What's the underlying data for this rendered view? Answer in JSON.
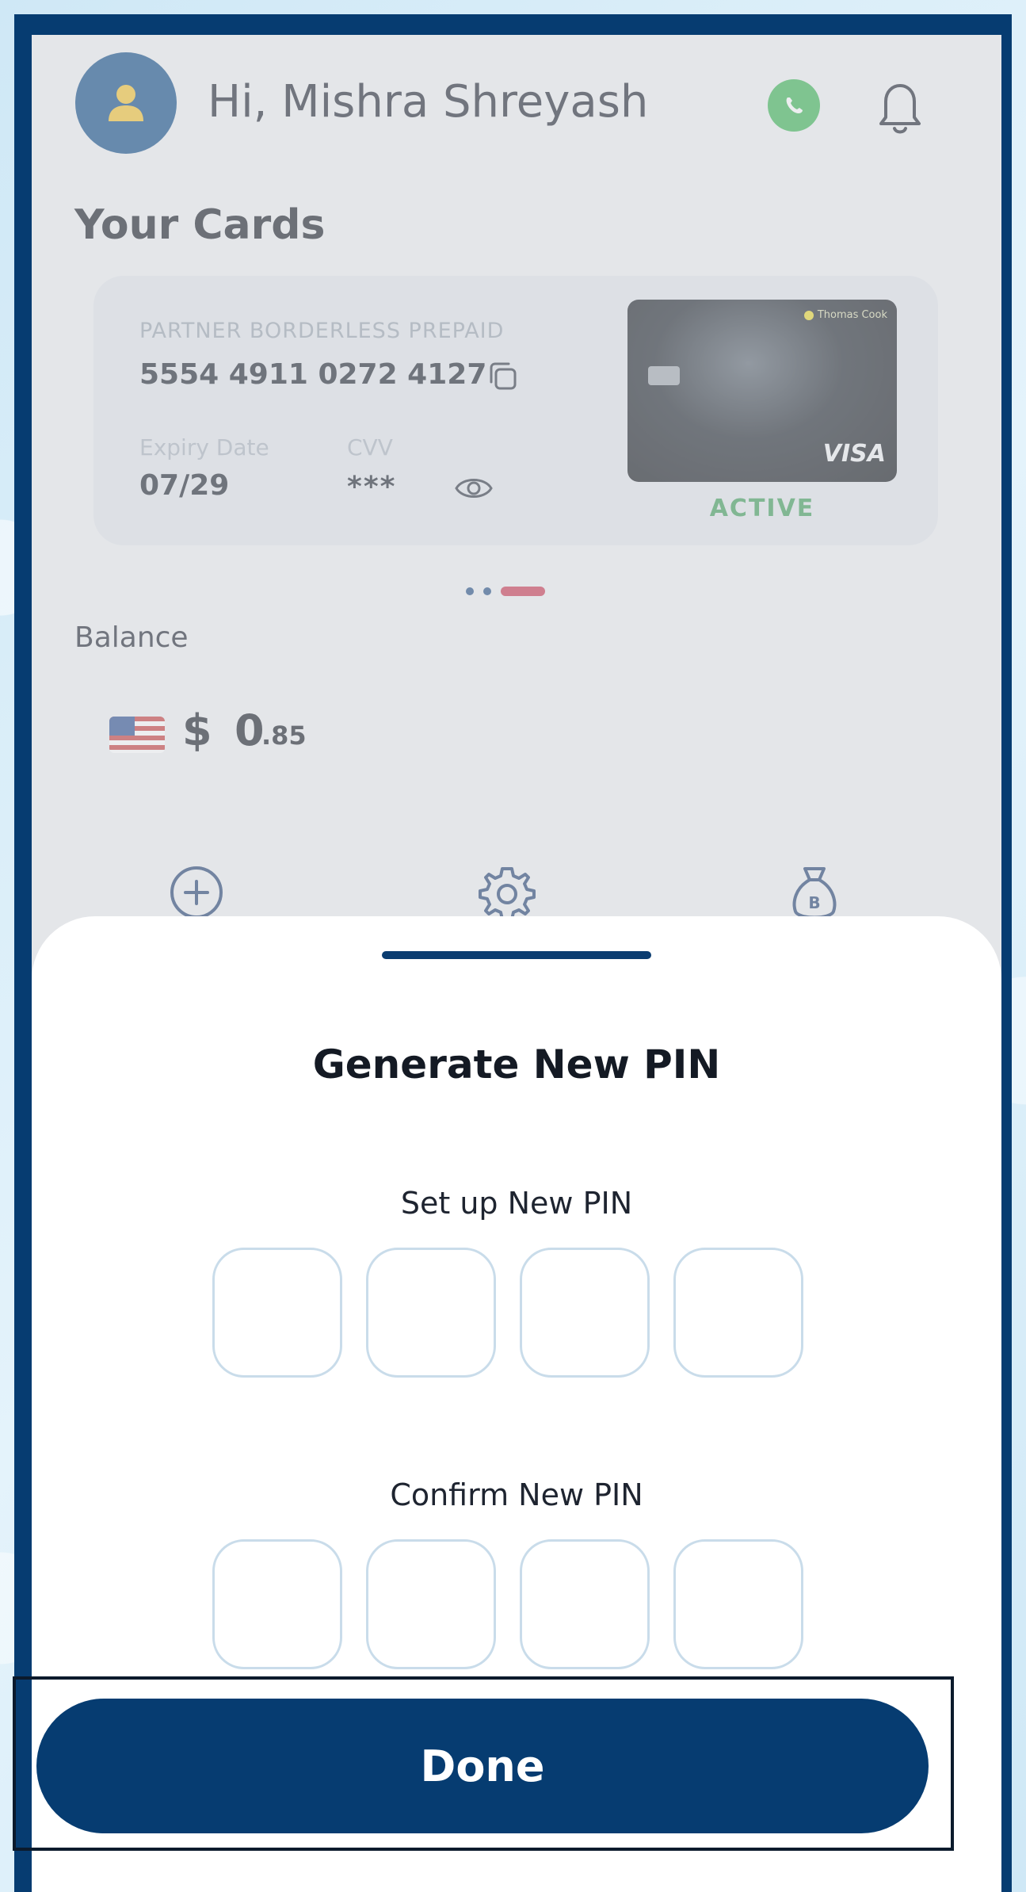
{
  "header": {
    "greeting": "Hi, Mishra Shreyash",
    "avatar_icon": "user-icon",
    "whatsapp_icon": "whatsapp-icon",
    "notification_icon": "bell-icon"
  },
  "cards": {
    "section_title": "Your Cards",
    "card_type": "PARTNER BORDERLESS PREPAID",
    "card_number": "5554 4911 0272 4127",
    "expiry_label": "Expiry Date",
    "expiry_value": "07/29",
    "cvv_label": "CVV",
    "cvv_value": "***",
    "card_brand": "Thomas Cook",
    "network": "VISA",
    "status": "ACTIVE",
    "pagination": {
      "total": 3,
      "active_index": 2
    }
  },
  "balance": {
    "label": "Balance",
    "currency_symbol": "$",
    "amount_whole": "0",
    "amount_cents": ".85"
  },
  "actions": {
    "icons": [
      "add-circle-icon",
      "settings-gear-icon",
      "money-bag-icon"
    ]
  },
  "pin_sheet": {
    "title": "Generate New PIN",
    "set_label": "Set up New PIN",
    "confirm_label": "Confirm New PIN",
    "set_digits": [
      "",
      "",
      "",
      ""
    ],
    "confirm_digits": [
      "",
      "",
      "",
      ""
    ],
    "done_label": "Done"
  },
  "colors": {
    "primary": "#063c71",
    "active_status": "#3b9b57",
    "pagination_active": "#c8354f",
    "pin_border": "#c9dcea"
  }
}
